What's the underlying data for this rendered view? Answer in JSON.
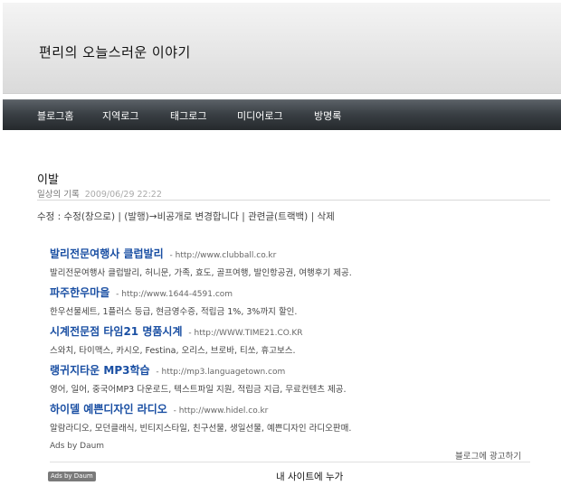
{
  "header": {
    "blog_title": "편리의 오늘스러운 이야기"
  },
  "nav": {
    "items": [
      {
        "label": "블로그홈"
      },
      {
        "label": "지역로그"
      },
      {
        "label": "태그로그"
      },
      {
        "label": "미디어로그"
      },
      {
        "label": "방명록"
      }
    ]
  },
  "post": {
    "title": "이발",
    "category": "일상의 기록",
    "date": "2009/06/29 22:22",
    "actions": {
      "edit": "수정",
      "edit_new_window": "수정(창으로)",
      "secret_toggle": "(발행)→비공개로 변경합니다",
      "trackback": "관련글(트랙백)",
      "delete": "삭제"
    }
  },
  "ads": {
    "items": [
      {
        "title": "발리전문여행사 클럽발리",
        "url": "http://www.clubball.co.kr",
        "desc": "발리전문여행사 클럽발리, 허니문, 가족, 효도, 골프여행, 발인항공권, 여행후기 제공."
      },
      {
        "title": "파주한우마을",
        "url": "http://www.1644-4591.com",
        "desc": "한우선물세트, 1플러스 등급, 현금영수증, 적립금 1%, 3%까지 할인."
      },
      {
        "title": "시계전문점 타임21 명품시계",
        "url": "http://WWW.TIME21.CO.KR",
        "desc": "스와치, 타이맥스, 카시오, Festina, 오리스, 브로바, 티쏘, 휴고보스."
      },
      {
        "title": "랭귀지타운 MP3학습",
        "url": "http://mp3.languagetown.com",
        "desc": "영어, 일어, 중국어MP3 다운로드, 텍스트파일 지원, 적립금 지급, 무료컨텐츠 제공."
      },
      {
        "title": "하이델 예쁜디자인 라디오",
        "url": "http://www.hidel.co.kr",
        "desc": "알람라디오, 모던클래식, 빈티지스타일, 친구선물, 생일선물, 예쁜디자인 라디오판매."
      }
    ],
    "ads_by_label": "Ads by Daum",
    "advertise_link": "블로그에 광고하기"
  },
  "footer": {
    "daum_badge": "Ads by Daum",
    "site_heading": "내 사이트에 누가"
  }
}
